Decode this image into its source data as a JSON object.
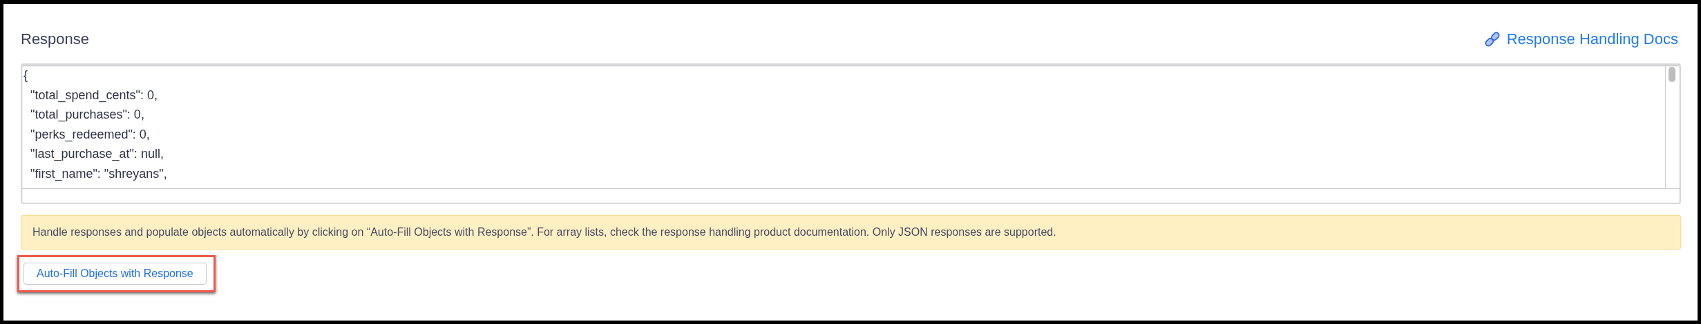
{
  "section": {
    "title": "Response"
  },
  "docs_link": {
    "label": "Response Handling Docs"
  },
  "response_body": {
    "lines": [
      "{",
      "  \"total_spend_cents\": 0,",
      "  \"total_purchases\": 0,",
      "  \"perks_redeemed\": 0,",
      "  \"last_purchase_at\": null,",
      "  \"first_name\": \"shreyans\","
    ]
  },
  "notice": {
    "text": "Handle responses and populate objects automatically by clicking on “Auto-Fill Objects with Response”. For array lists, check the response handling product documentation. Only JSON responses are supported."
  },
  "autofill_button": {
    "label": "Auto-Fill Objects with Response",
    "highlighted": true
  }
}
